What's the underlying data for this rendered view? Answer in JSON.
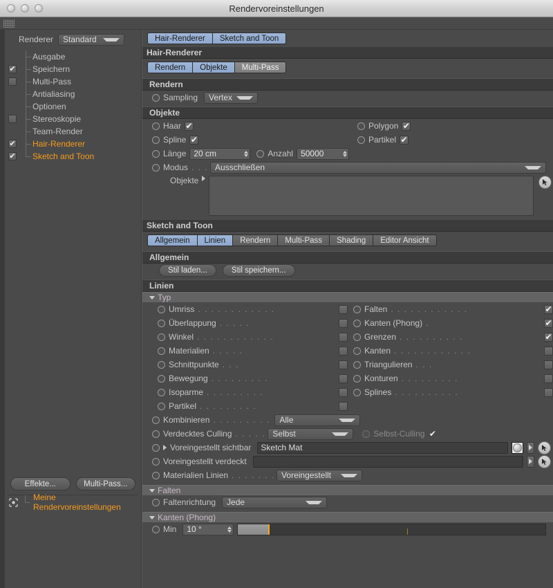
{
  "window": {
    "title": "Rendervoreinstellungen",
    "traffic_lights": [
      "close",
      "minimize",
      "zoom"
    ]
  },
  "sidebar": {
    "renderer_label": "Renderer",
    "renderer_value": "Standard",
    "tree": [
      {
        "label": "Ausgabe",
        "check": "none",
        "highlight": false
      },
      {
        "label": "Speichern",
        "check": "on",
        "highlight": false
      },
      {
        "label": "Multi-Pass",
        "check": "off",
        "highlight": false
      },
      {
        "label": "Antialiasing",
        "check": "none",
        "highlight": false
      },
      {
        "label": "Optionen",
        "check": "none",
        "highlight": false
      },
      {
        "label": "Stereoskopie",
        "check": "off",
        "highlight": false
      },
      {
        "label": "Team-Render",
        "check": "none",
        "highlight": false
      },
      {
        "label": "Hair-Renderer",
        "check": "on",
        "highlight": true
      },
      {
        "label": "Sketch and Toon",
        "check": "on",
        "highlight": true
      }
    ],
    "effects_button": "Effekte...",
    "multipass_button": "Multi-Pass...",
    "preset_label": "Meine Rendervoreinstellungen"
  },
  "top_tabs": [
    {
      "label": "Hair-Renderer",
      "state": "active"
    },
    {
      "label": "Sketch and Toon",
      "state": "active"
    }
  ],
  "hair": {
    "title": "Hair-Renderer",
    "tabs": [
      {
        "label": "Rendern",
        "state": "active"
      },
      {
        "label": "Objekte",
        "state": "active"
      },
      {
        "label": "Multi-Pass",
        "state": "dim"
      }
    ],
    "render_group": "Rendern",
    "sampling_label": "Sampling",
    "sampling_value": "Vertex",
    "objects_group": "Objekte",
    "toggles": [
      {
        "label": "Haar",
        "checked": true
      },
      {
        "label": "Polygon",
        "checked": true
      },
      {
        "label": "Spline",
        "checked": true
      },
      {
        "label": "Partikel",
        "checked": true
      }
    ],
    "laenge_label": "Länge",
    "laenge_value": "20 cm",
    "anzahl_label": "Anzahl",
    "anzahl_value": "50000",
    "modus_label": "Modus",
    "modus_value": "Ausschließen",
    "objekte_label": "Objekte",
    "objekte_value": ""
  },
  "sketch": {
    "title": "Sketch and Toon",
    "tabs": [
      {
        "label": "Allgemein",
        "state": "active"
      },
      {
        "label": "Linien",
        "state": "active"
      },
      {
        "label": "Rendern",
        "state": "inactive"
      },
      {
        "label": "Multi-Pass",
        "state": "inactive"
      },
      {
        "label": "Shading",
        "state": "inactive"
      },
      {
        "label": "Editor Ansicht",
        "state": "inactive"
      }
    ],
    "allgemein_group": "Allgemein",
    "style_load_button": "Stil laden...",
    "style_save_button": "Stil speichern...",
    "linien_group": "Linien",
    "typ_group": "Typ",
    "typ_left": [
      {
        "label": "Umriss",
        "checked": false
      },
      {
        "label": "Überlappung",
        "checked": false
      },
      {
        "label": "Winkel",
        "checked": false
      },
      {
        "label": "Materialien",
        "checked": false
      },
      {
        "label": "Schnittpunkte",
        "checked": false
      },
      {
        "label": "Bewegung",
        "checked": false
      },
      {
        "label": "Isoparme",
        "checked": false
      },
      {
        "label": "Partikel",
        "checked": false
      }
    ],
    "typ_right": [
      {
        "label": "Falten",
        "checked": true
      },
      {
        "label": "Kanten (Phong)",
        "checked": true
      },
      {
        "label": "Grenzen",
        "checked": true
      },
      {
        "label": "Kanten",
        "checked": false
      },
      {
        "label": "Triangulieren",
        "checked": false
      },
      {
        "label": "Konturen",
        "checked": false
      },
      {
        "label": "Splines",
        "checked": false
      }
    ],
    "kombinieren_label": "Kombinieren",
    "kombinieren_value": "Alle",
    "culling_label": "Verdecktes Culling",
    "culling_value": "Selbst",
    "self_culling_label": "Selbst-Culling",
    "self_culling_checked": true,
    "visible_label": "Voreingestellt sichtbar",
    "visible_value": "Sketch Mat",
    "hidden_label": "Voreingestellt verdeckt",
    "hidden_value": "",
    "mat_lines_label": "Materialien Linien",
    "mat_lines_value": "Voreingestellt",
    "falten_group": "Falten",
    "faltenrichtung_label": "Faltenrichtung",
    "faltenrichtung_value": "Jede",
    "phong_group": "Kanten (Phong)",
    "min_label": "Min",
    "min_value": "10 °",
    "min_slider_percent": 10,
    "min_slider_tick_percent": 55
  },
  "colors": {
    "accent_orange": "#f79c1e",
    "tab_active_blue": "#8ea8ce",
    "panel_bg": "#4a4a4a",
    "header_bg": "#3b3b3b",
    "subheader_bg": "#636363",
    "slider_handle": "#f5a623"
  }
}
